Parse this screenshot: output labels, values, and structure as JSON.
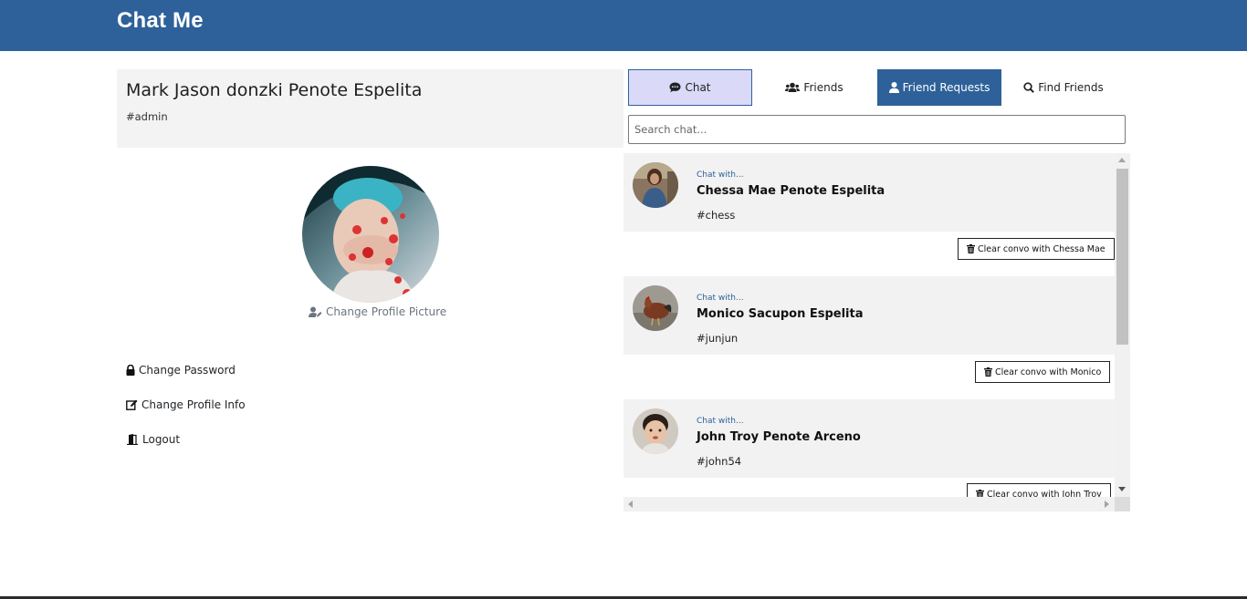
{
  "app": {
    "title": "Chat Me"
  },
  "profile": {
    "name": "Mark Jason donzki Penote Espelita",
    "tag": "#admin",
    "change_picture_label": "Change Profile Picture"
  },
  "menu": {
    "change_password": "Change Password",
    "change_profile_info": "Change Profile Info",
    "logout": "Logout"
  },
  "tabs": {
    "chat": "Chat",
    "friends": "Friends",
    "friend_requests": "Friend Requests",
    "find_friends": "Find Friends",
    "active": "chat"
  },
  "search": {
    "placeholder": "Search chat...",
    "value": ""
  },
  "chats": [
    {
      "caption": "Chat with...",
      "name": "Chessa Mae Penote Espelita",
      "tag": "#chess",
      "clear_label": "Clear convo with Chessa Mae"
    },
    {
      "caption": "Chat with...",
      "name": "Monico Sacupon Espelita",
      "tag": "#junjun",
      "clear_label": "Clear convo with Monico"
    },
    {
      "caption": "Chat with...",
      "name": "John Troy Penote Arceno",
      "tag": "#john54",
      "clear_label": "Clear convo with John Troy"
    }
  ],
  "colors": {
    "brand": "#2e6199",
    "active_tab_bg": "#dadaf8",
    "card_bg": "#f2f2f2"
  }
}
